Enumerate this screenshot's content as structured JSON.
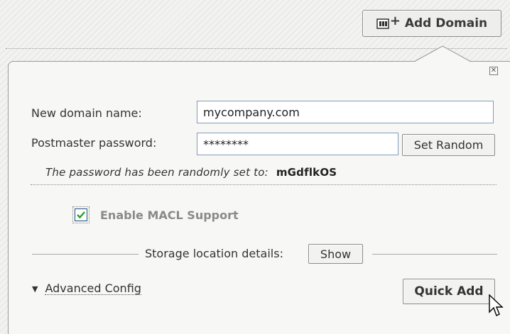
{
  "toolbar": {
    "add_domain_label": "Add Domain",
    "add_domain_icon": "domain-add-icon"
  },
  "panel": {
    "close_icon": "close-icon",
    "domain_name_label": "New domain name:",
    "domain_name_value": "mycompany.com",
    "password_label": "Postmaster password:",
    "password_value": "********",
    "set_random_label": "Set Random",
    "random_note": "The password has been randomly set to:",
    "random_password": "mGdflkOS",
    "macl_label": "Enable MACL Support",
    "macl_checked": true,
    "storage_label": "Storage location details:",
    "show_label": "Show",
    "advanced_label": "Advanced Config",
    "quick_add_label": "Quick Add"
  },
  "colors": {
    "border": "#9a9a9a",
    "input_border": "#7f9db9",
    "check_mark": "#21a121"
  }
}
